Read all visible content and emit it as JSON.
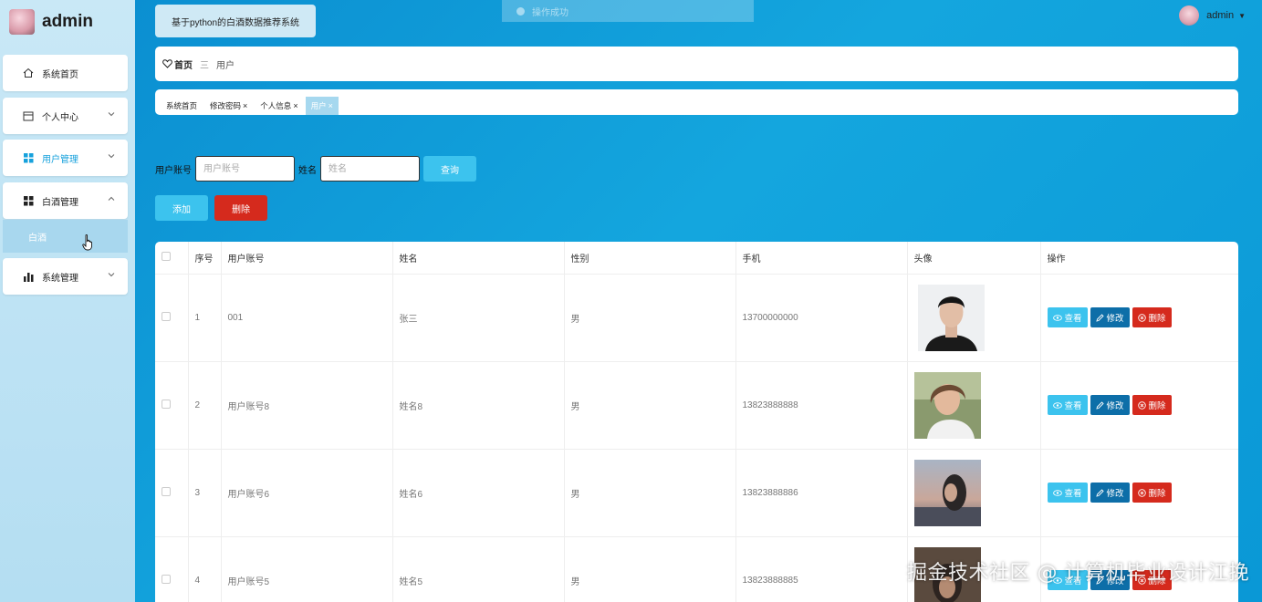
{
  "brand": {
    "title": "admin"
  },
  "sidebar": {
    "items": [
      {
        "label": "系统首页"
      },
      {
        "label": "个人中心"
      },
      {
        "label": "用户管理"
      },
      {
        "label": "白酒管理"
      },
      {
        "label": "系统管理"
      }
    ],
    "submenu_label": "白酒"
  },
  "header": {
    "system_title": "基于python的白酒数据推荐系统",
    "toast": "操作成功",
    "username": "admin"
  },
  "breadcrumb": {
    "home": "首页",
    "separator": "三",
    "current": "用户"
  },
  "tags": [
    {
      "label": "系统首页",
      "closable": false
    },
    {
      "label": "修改密码",
      "closable": true
    },
    {
      "label": "个人信息",
      "closable": true
    },
    {
      "label": "用户",
      "closable": true
    }
  ],
  "tag_close": "×",
  "search": {
    "account_label": "用户账号",
    "account_placeholder": "用户账号",
    "name_label": "姓名",
    "name_placeholder": "姓名",
    "query_label": "查询"
  },
  "actions": {
    "add_label": "添加",
    "delete_label": "删除"
  },
  "table": {
    "headers": [
      "序号",
      "用户账号",
      "姓名",
      "性别",
      "手机",
      "头像",
      "操作"
    ],
    "op_labels": {
      "view": "查看",
      "edit": "修改",
      "delete": "删除"
    },
    "rows": [
      {
        "index": "1",
        "account": "001",
        "name": "张三",
        "gender": "男",
        "phone": "13700000000"
      },
      {
        "index": "2",
        "account": "用户账号8",
        "name": "姓名8",
        "gender": "男",
        "phone": "13823888888"
      },
      {
        "index": "3",
        "account": "用户账号6",
        "name": "姓名6",
        "gender": "男",
        "phone": "13823888886"
      },
      {
        "index": "4",
        "account": "用户账号5",
        "name": "姓名5",
        "gender": "男",
        "phone": "13823888885"
      }
    ]
  },
  "watermark": "掘金技术社区 @ 计算机毕业设计江挽",
  "colors": {
    "accent": "#3cc3ee",
    "danger": "#d52a1d",
    "edit": "#0d6ea8",
    "background": "#0a9ad9"
  }
}
